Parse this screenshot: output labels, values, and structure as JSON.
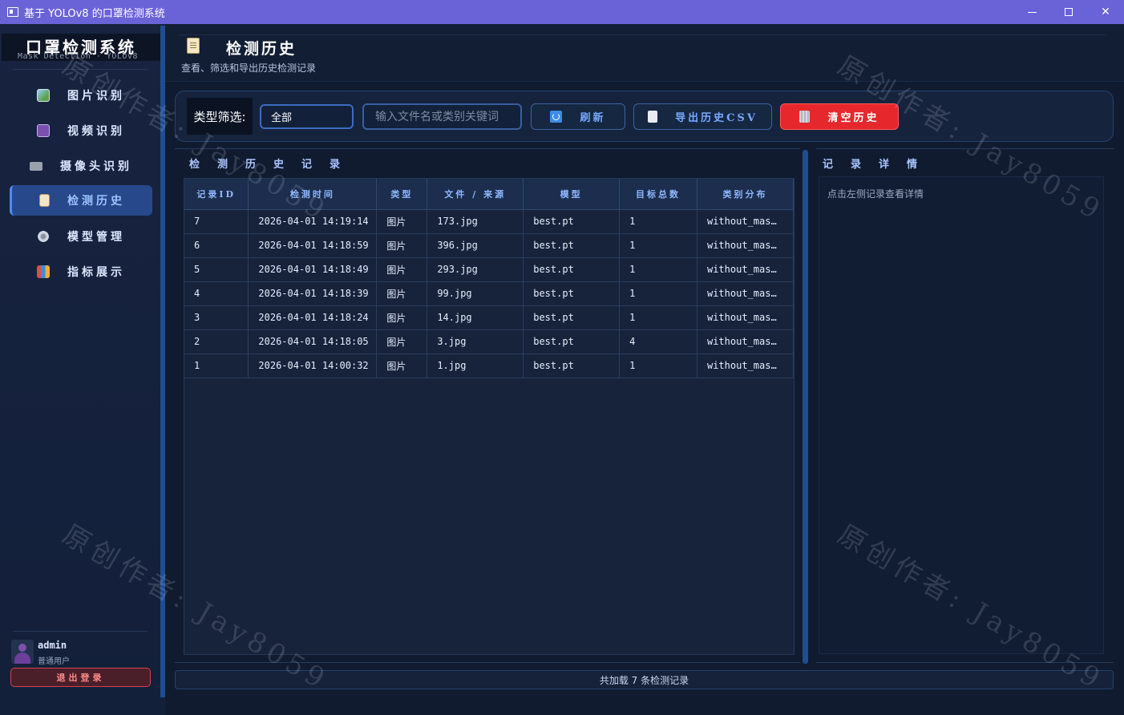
{
  "window": {
    "title": "基于 YOLOv8 的口罩检测系统"
  },
  "brand": {
    "title": "口罩检测系统",
    "subtitle": "Mask Detection  ·  YOLOv8"
  },
  "nav": {
    "items": [
      {
        "label": "图片识别",
        "icon": "image-icon"
      },
      {
        "label": "视频识别",
        "icon": "video-icon"
      },
      {
        "label": "摄像头识别",
        "icon": "camera-icon"
      },
      {
        "label": "检测历史",
        "icon": "history-icon",
        "active": true
      },
      {
        "label": "模型管理",
        "icon": "gear-icon"
      },
      {
        "label": "指标展示",
        "icon": "chart-icon"
      }
    ]
  },
  "user": {
    "name": "admin",
    "role": "普通用户",
    "logout_label": "退出登录"
  },
  "header": {
    "title": "检测历史",
    "subtitle": "查看、筛选和导出历史检测记录"
  },
  "toolbar": {
    "filter_label": "类型筛选:",
    "filter_value": "全部",
    "search_placeholder": "输入文件名或类别关键词",
    "refresh_label": "刷新",
    "export_label": "导出历史CSV",
    "clear_label": "清空历史"
  },
  "records": {
    "section_title": "检测历史记录",
    "columns": [
      "记录ID",
      "检测时间",
      "类型",
      "文件 / 来源",
      "模型",
      "目标总数",
      "类别分布"
    ],
    "rows": [
      [
        "7",
        "2026-04-01 14:19:14",
        "图片",
        "173.jpg",
        "best.pt",
        "1",
        "without_mas…"
      ],
      [
        "6",
        "2026-04-01 14:18:59",
        "图片",
        "396.jpg",
        "best.pt",
        "1",
        "without_mas…"
      ],
      [
        "5",
        "2026-04-01 14:18:49",
        "图片",
        "293.jpg",
        "best.pt",
        "1",
        "without_mas…"
      ],
      [
        "4",
        "2026-04-01 14:18:39",
        "图片",
        "99.jpg",
        "best.pt",
        "1",
        "without_mas…"
      ],
      [
        "3",
        "2026-04-01 14:18:24",
        "图片",
        "14.jpg",
        "best.pt",
        "1",
        "without_mas…"
      ],
      [
        "2",
        "2026-04-01 14:18:05",
        "图片",
        "3.jpg",
        "best.pt",
        "4",
        "without_mas…"
      ],
      [
        "1",
        "2026-04-01 14:00:32",
        "图片",
        "1.jpg",
        "best.pt",
        "1",
        "without_mas…"
      ]
    ]
  },
  "detail": {
    "section_title": "记录详情",
    "placeholder": "点击左侧记录查看详情"
  },
  "footer": {
    "status": "共加载 7 条检测记录"
  },
  "watermark": {
    "text": "原创作者: Jay8059"
  },
  "colors": {
    "title_bar": "#6a63d8",
    "accent": "#4d8bff",
    "danger": "#e6272b"
  }
}
